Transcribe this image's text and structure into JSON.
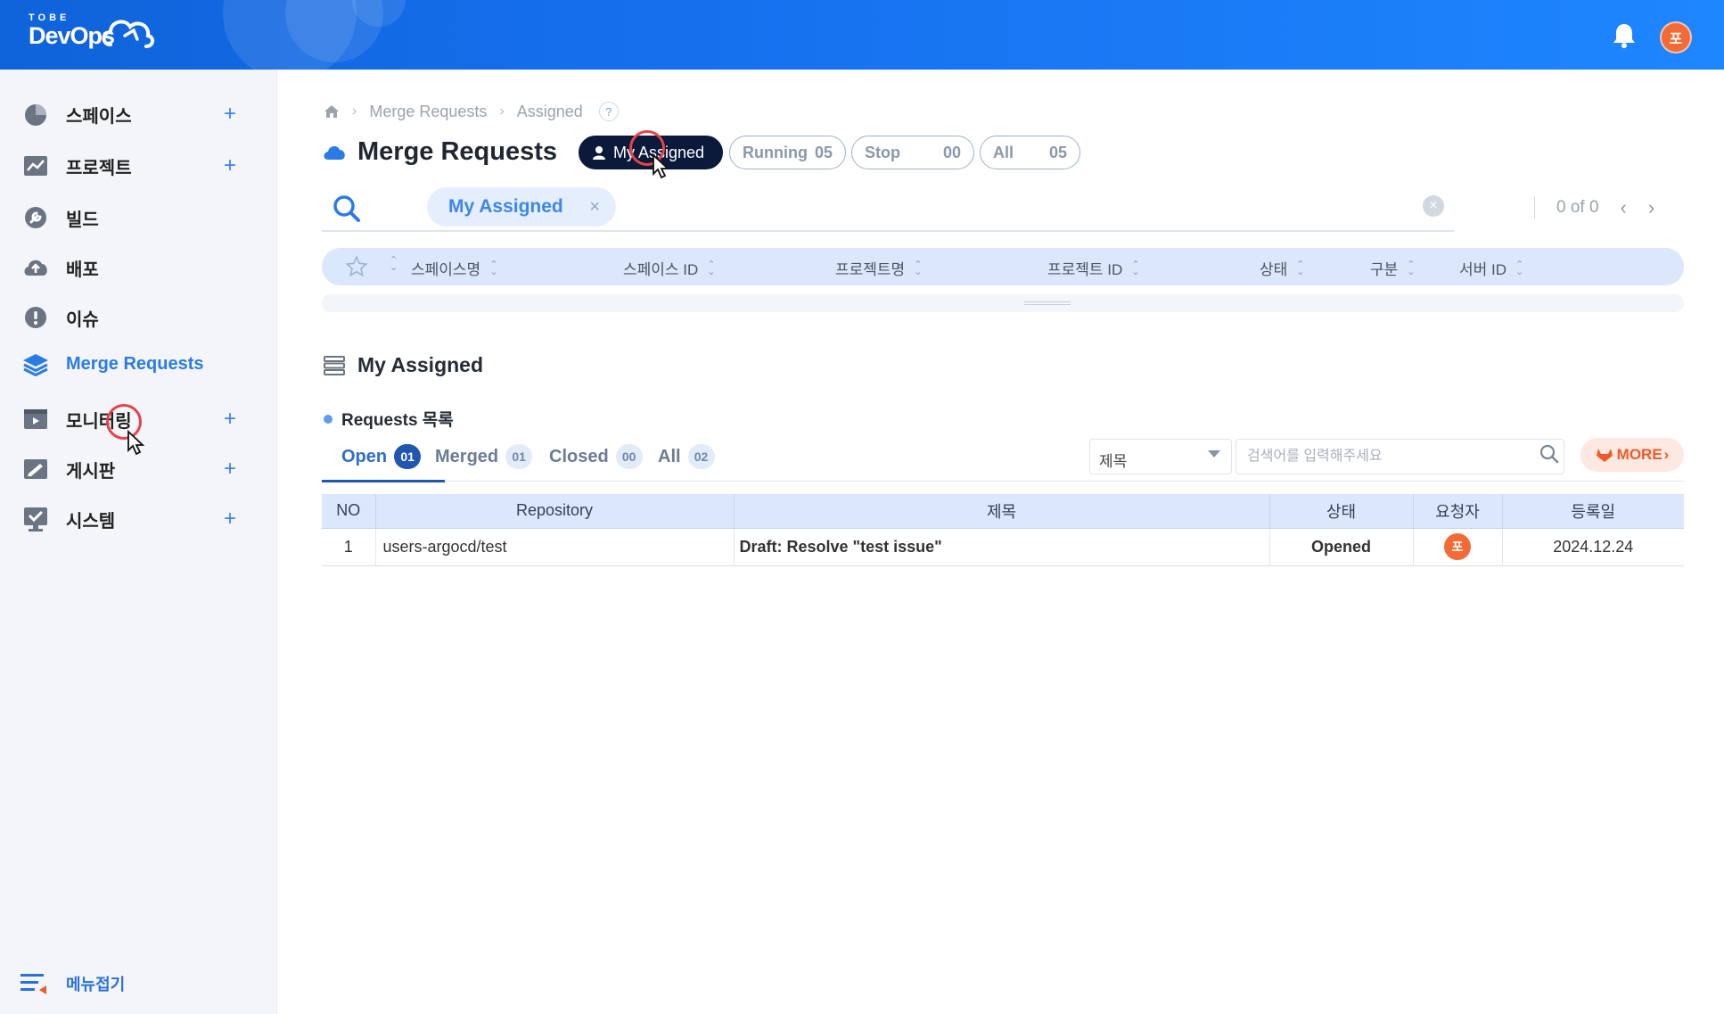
{
  "header": {
    "logo_top": "TOBE",
    "logo_main": "DevOps",
    "user_initial": "포"
  },
  "sidebar": {
    "items": [
      {
        "label": "스페이스",
        "icon": "pie-chart-icon",
        "has_plus": true
      },
      {
        "label": "프로젝트",
        "icon": "chart-board-icon",
        "has_plus": true
      },
      {
        "label": "빌드",
        "icon": "wrench-icon",
        "has_plus": false
      },
      {
        "label": "배포",
        "icon": "cloud-upload-icon",
        "has_plus": false
      },
      {
        "label": "이슈",
        "icon": "alert-icon",
        "has_plus": false
      },
      {
        "label": "Merge Requests",
        "icon": "layers-icon",
        "has_plus": false,
        "active": true
      },
      {
        "label": "모니터링",
        "icon": "monitor-icon",
        "has_plus": true
      },
      {
        "label": "게시판",
        "icon": "board-icon",
        "has_plus": true
      },
      {
        "label": "시스템",
        "icon": "system-icon",
        "has_plus": true
      }
    ],
    "plus": "+",
    "collapse_label": "메뉴접기"
  },
  "breadcrumb": {
    "items": [
      "Merge Requests",
      "Assigned"
    ],
    "help": "?"
  },
  "page": {
    "title": "Merge Requests",
    "filters": [
      {
        "label": "My Assigned",
        "count": ""
      },
      {
        "label": "Running",
        "count": "05"
      },
      {
        "label": "Stop",
        "count": "00"
      },
      {
        "label": "All",
        "count": "05"
      }
    ]
  },
  "search": {
    "chip": "My Assigned",
    "chip_close": "×",
    "pager": "0 of 0"
  },
  "grid": {
    "columns": [
      "스페이스명",
      "스페이스 ID",
      "프로젝트명",
      "프로젝트 ID",
      "상태",
      "구분",
      "서버 ID"
    ]
  },
  "section": {
    "title": "My Assigned",
    "list_title": "Requests 목록"
  },
  "tabs": [
    {
      "label": "Open",
      "count": "01"
    },
    {
      "label": "Merged",
      "count": "01"
    },
    {
      "label": "Closed",
      "count": "00"
    },
    {
      "label": "All",
      "count": "02"
    }
  ],
  "search_filter": {
    "select_value": "제목",
    "placeholder": "검색어를 입력해주세요",
    "more_label": "MORE"
  },
  "table": {
    "headers": [
      "NO",
      "Repository",
      "제목",
      "상태",
      "요청자",
      "등록일"
    ],
    "rows": [
      {
        "no": "1",
        "repository": "users-argocd/test",
        "title": "Draft: Resolve \"test issue\"",
        "status": "Opened",
        "requester": "포",
        "date": "2024.12.24"
      }
    ]
  },
  "colors": {
    "header_blue": "#1670ee",
    "active_text": "#2b7be4",
    "avatar": "#f26a35",
    "status_blue": "#1f57b0"
  }
}
